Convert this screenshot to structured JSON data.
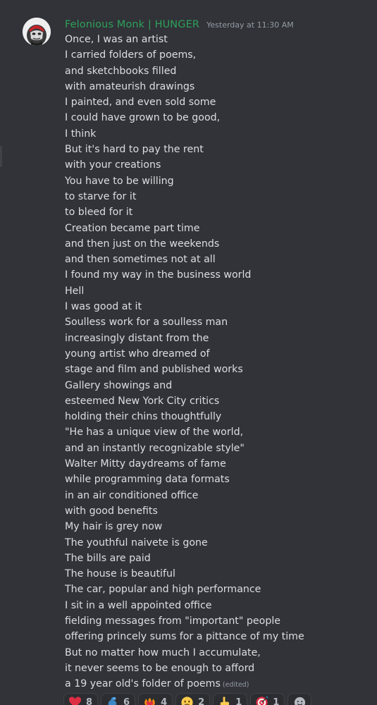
{
  "message": {
    "username": "Felonious Monk | HUNGER",
    "timestamp": "Yesterday at 11:30 AM",
    "edited_label": "(edited)",
    "lines": [
      "Once, I was an artist",
      "I carried folders of poems,",
      "and sketchbooks filled",
      "with amateurish drawings",
      "I painted, and even sold some",
      "I could have grown to be good,",
      "I think",
      "But it's hard to pay the rent",
      "with your creations",
      "You have to be willing",
      "to starve for it",
      "to bleed for it",
      "Creation became part time",
      "and then just on the weekends",
      "and then sometimes not at all",
      "I found my way in the business world",
      "Hell",
      "I was good at it",
      "Soulless work for a soulless man",
      "increasingly distant from the",
      "young artist who dreamed of",
      "stage and film and published works",
      "Gallery showings and",
      "esteemed New York City critics",
      "holding their chins thoughtfully",
      "\"He has a unique view of the world,",
      "and an instantly recognizable style\"",
      "Walter Mitty daydreams of fame",
      "while programming data formats",
      "in an air conditioned office",
      "with good benefits",
      "My hair is grey now",
      "The youthful naivete is gone",
      "The bills are paid",
      "The house is beautiful",
      "The car, popular and high performance",
      "I sit in a well appointed office",
      "fielding messages from \"important\" people",
      "offering princely sums for a pittance of my time",
      "But no matter how much I accumulate,",
      "it never seems to be enough to afford",
      "a 19 year old's folder of poems"
    ]
  },
  "reactions": [
    {
      "icon": "red-heart-icon",
      "count": "8"
    },
    {
      "icon": "blue-flexed-arm-icon",
      "count": "6"
    },
    {
      "icon": "heart-on-fire-icon",
      "count": "4"
    },
    {
      "icon": "crying-face-icon",
      "count": "2"
    },
    {
      "icon": "pointing-hand-icon",
      "count": "1"
    },
    {
      "icon": "direct-hit-icon",
      "count": "1"
    }
  ],
  "colors": {
    "background": "#313338",
    "username": "#2fa05a",
    "text": "#dbdee1",
    "muted": "#949ba4",
    "reaction_bg": "#2b2d31"
  }
}
